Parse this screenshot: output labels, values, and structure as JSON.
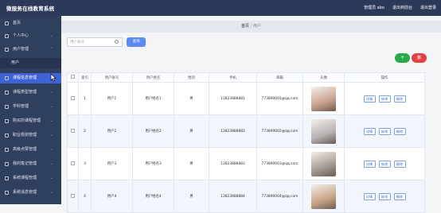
{
  "app": {
    "title": "微服务在线教育系统"
  },
  "top_links": [
    "管理员 abo",
    "退出到前台",
    "退出登录"
  ],
  "sidebar": {
    "items": [
      {
        "label": "首页",
        "icon": "home-icon"
      },
      {
        "label": "个人中心",
        "icon": "user-icon"
      },
      {
        "label": "用户管理",
        "icon": "users-icon"
      },
      {
        "label": "用户",
        "icon": ""
      },
      {
        "label": "课程信息管理",
        "icon": "book-icon"
      },
      {
        "label": "课程类型管理",
        "icon": "folder-icon"
      },
      {
        "label": "学科管理",
        "icon": "list-icon"
      },
      {
        "label": "购买的课程管理",
        "icon": "cart-icon"
      },
      {
        "label": "职业规划管理",
        "icon": "briefcase-icon"
      },
      {
        "label": "高级点赞管理",
        "icon": "thumb-icon"
      },
      {
        "label": "我的笔记管理",
        "icon": "note-icon"
      },
      {
        "label": "系统课程管理",
        "icon": "grid-icon"
      },
      {
        "label": "系统消息管理",
        "icon": "message-icon"
      }
    ]
  },
  "breadcrumb": {
    "home": "首页",
    "sep": "/",
    "current": "用户"
  },
  "search": {
    "placeholder": "用户账号",
    "button": "查询"
  },
  "toolbar": {
    "add": "+",
    "delete": "删"
  },
  "table": {
    "headers": [
      "",
      "索引",
      "用户账号",
      "用户姓名",
      "性别",
      "手机",
      "邮箱",
      "头像",
      "操作"
    ],
    "rows": [
      {
        "index": "1",
        "account": "用户1",
        "name": "用户姓名1",
        "gender": "男",
        "phone": "13823888881",
        "email": "773890001@qq.com",
        "photo_color": "#c9a28e"
      },
      {
        "index": "2",
        "account": "用户2",
        "name": "用户姓名2",
        "gender": "男",
        "phone": "13823888882",
        "email": "773890002@qq.com",
        "photo_color": "#b7b2b4"
      },
      {
        "index": "3",
        "account": "用户3",
        "name": "用户姓名3",
        "gender": "男",
        "phone": "13823888883",
        "email": "773890003@qq.com",
        "photo_color": "#a49a94"
      },
      {
        "index": "4",
        "account": "用户4",
        "name": "用户姓名4",
        "gender": "男",
        "phone": "13823888884",
        "email": "773890004@qq.com",
        "photo_color": "#c8a487"
      }
    ],
    "actions": [
      "详情",
      "修改",
      "删除"
    ]
  }
}
